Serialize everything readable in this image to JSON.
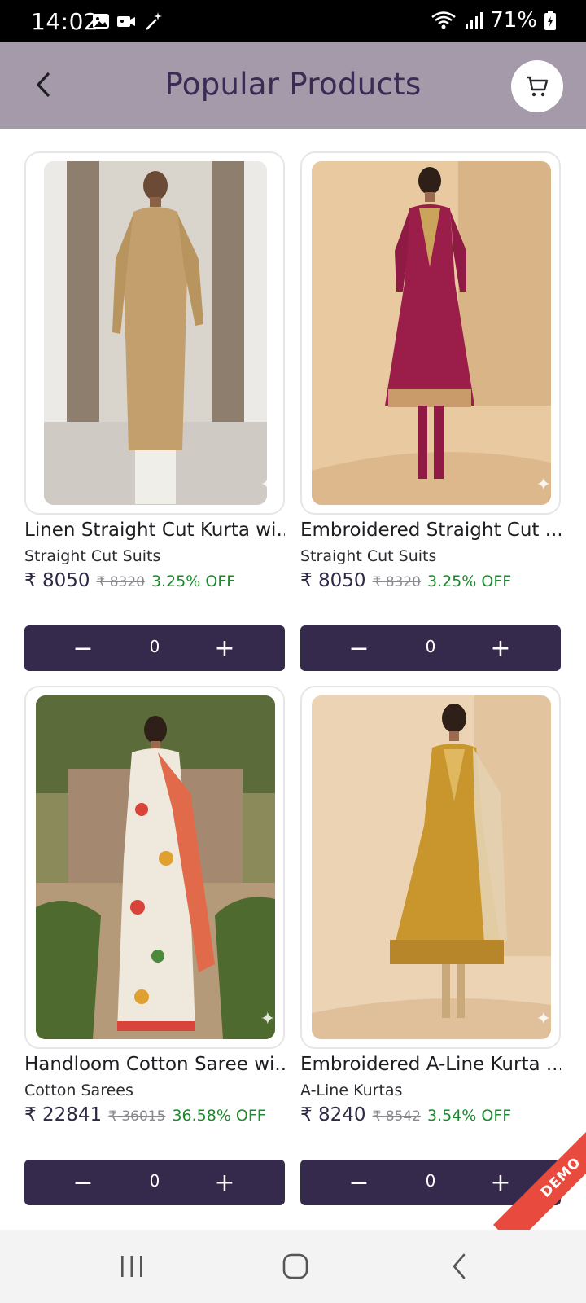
{
  "status_bar": {
    "time": "14:02",
    "battery": "71%"
  },
  "header": {
    "title": "Popular Products"
  },
  "products": [
    {
      "name": "Linen Straight Cut Kurta wi...",
      "category": "Straight Cut Suits",
      "price": "₹ 8050",
      "mrp": "₹ 8320",
      "discount": "3.25% OFF",
      "quantity": "0"
    },
    {
      "name": "Embroidered Straight Cut ...",
      "category": "Straight Cut Suits",
      "price": "₹ 8050",
      "mrp": "₹ 8320",
      "discount": "3.25% OFF",
      "quantity": "0"
    },
    {
      "name": "Handloom Cotton Saree wi...",
      "category": "Cotton Sarees",
      "price": "₹ 22841",
      "mrp": "₹ 36015",
      "discount": "36.58% OFF",
      "quantity": "0"
    },
    {
      "name": "Embroidered A-Line Kurta ...",
      "category": "A-Line Kurtas",
      "price": "₹ 8240",
      "mrp": "₹ 8542",
      "discount": "3.54% OFF",
      "quantity": "0"
    }
  ],
  "stepper": {
    "minus": "−",
    "plus": "+"
  },
  "ribbon": {
    "label": "DEMO"
  },
  "colors": {
    "app_bar": "#a49aa9",
    "title": "#3a2b55",
    "stepper": "#352a4c",
    "discount": "#1a8a2a",
    "ribbon": "#e84a3e"
  }
}
